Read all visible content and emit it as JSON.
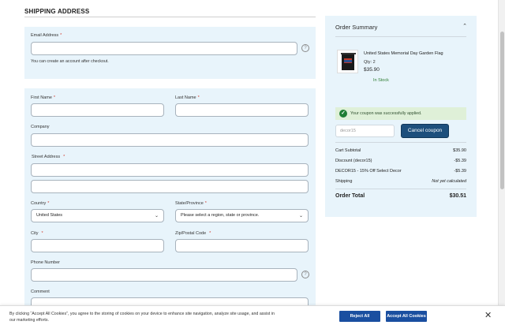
{
  "page": {
    "title": "SHIPPING ADDRESS"
  },
  "email": {
    "label": "Email Address",
    "required_mark": "*",
    "value": "",
    "hint": "You can create an account after checkout.",
    "help_glyph": "?"
  },
  "address": {
    "first_name": {
      "label": "First Name",
      "required_mark": "*",
      "value": ""
    },
    "last_name": {
      "label": "Last Name",
      "required_mark": "*",
      "value": ""
    },
    "company": {
      "label": "Company",
      "value": ""
    },
    "street": {
      "label": "Street Address",
      "required_mark": "*",
      "line1": "",
      "line2": ""
    },
    "country": {
      "label": "Country",
      "required_mark": "*",
      "selected": "United States"
    },
    "state": {
      "label": "State/Province",
      "required_mark": "*",
      "selected": "Please select a region, state or province."
    },
    "city": {
      "label": "City",
      "required_mark": "*",
      "value": ""
    },
    "zip": {
      "label": "Zip/Postal Code",
      "required_mark": "*",
      "value": ""
    },
    "phone": {
      "label": "Phone Number",
      "value": "",
      "help_glyph": "?"
    },
    "comment": {
      "label": "Comment",
      "value": ""
    }
  },
  "summary": {
    "title": "Order Summary",
    "collapse_icon": "chevron-up-icon",
    "product": {
      "name": "United States Memorial Day Garden Flag",
      "qty": "Qty: 2",
      "price": "$35.90",
      "stock": "In Stock"
    },
    "coupon_success": "Your coupon was successfully applied.",
    "coupon_code": "decor15",
    "cancel_label": "Cancel coupon",
    "totals": [
      {
        "label": "Cart Subtotal",
        "value": "$35.90",
        "italic": false
      },
      {
        "label": "Discount (decor15)",
        "value": "-$5.39",
        "italic": false
      },
      {
        "label": "DECOR15 - 15% Off Select Decor",
        "value": "-$5.39",
        "italic": false
      },
      {
        "label": "Shipping",
        "value": "Not yet calculated",
        "italic": true
      }
    ],
    "order_total_label": "Order Total",
    "order_total_value": "$30.51"
  },
  "cookie": {
    "text": "By clicking “Accept All Cookies”, you agree to the storing of cookies on your device to enhance site navigation, analyze site usage, and assist in our marketing efforts.",
    "reject_label": "Reject All",
    "accept_label": "Accept All Cookies",
    "close_glyph": "✕"
  },
  "colors": {
    "panel_bg": "#e8f4fb",
    "primary_button": "#1d4f7c",
    "cookie_button": "#1a4fa0",
    "success_bg": "#dff0d8",
    "stock_green": "#2e7d32"
  }
}
